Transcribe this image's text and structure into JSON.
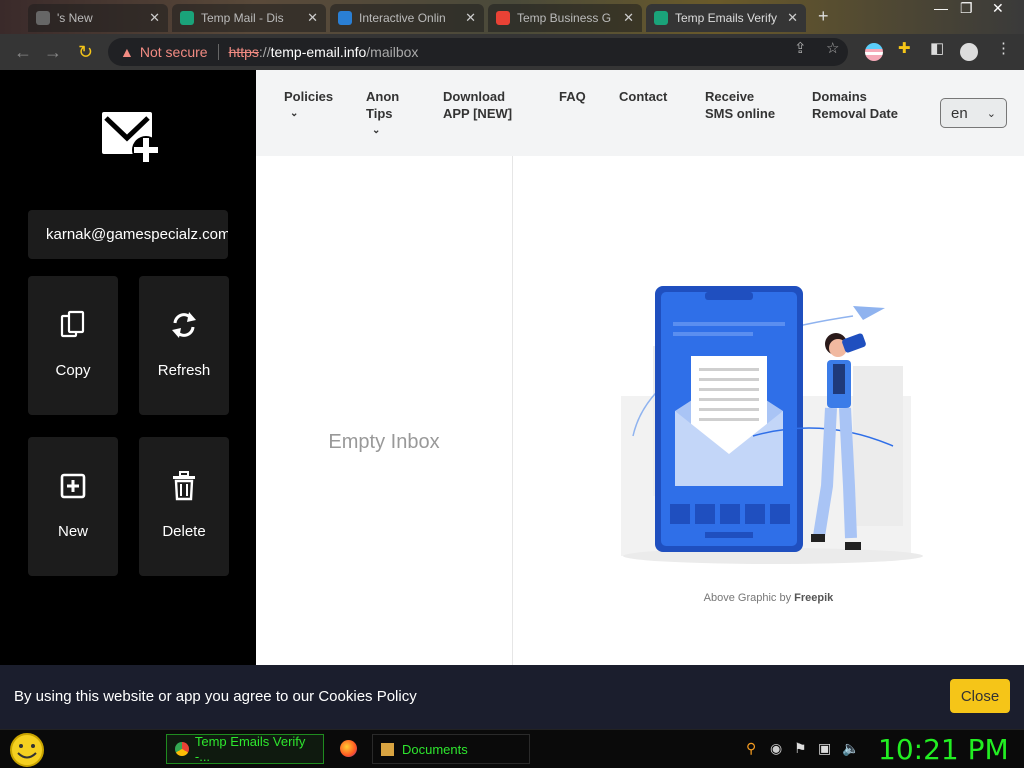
{
  "browser": {
    "tabs": [
      {
        "label": "'s New",
        "favicon_color": "#666666"
      },
      {
        "label": "Temp Mail - Dis",
        "favicon_color": "#1aa37a"
      },
      {
        "label": "Interactive Onlin",
        "favicon_color": "#2a7fd4"
      },
      {
        "label": "Temp Business G",
        "favicon_color": "#e94235"
      },
      {
        "label": "Temp Emails Verify",
        "favicon_color": "#1aa37a"
      }
    ],
    "close_glyph": "✕",
    "new_tab": "+",
    "window_controls": {
      "minimize": "—",
      "maximize": "❐",
      "close": "✕"
    },
    "address": {
      "not_secure": "Not secure",
      "scheme": "https",
      "separator": "://",
      "host": "temp-email.info",
      "path": "/mailbox"
    }
  },
  "sidebar": {
    "email": "karnak@gamespecialz.com",
    "actions": [
      {
        "label": "Copy",
        "icon": "copy-icon"
      },
      {
        "label": "Refresh",
        "icon": "refresh-icon"
      },
      {
        "label": "New",
        "icon": "plus-square-icon"
      },
      {
        "label": "Delete",
        "icon": "trash-icon"
      }
    ]
  },
  "nav": {
    "items": [
      {
        "line1": "Policies",
        "line2": "",
        "dropdown": true
      },
      {
        "line1": "Anon",
        "line2": "Tips",
        "dropdown": true
      },
      {
        "line1": "Download",
        "line2": "APP [NEW]",
        "dropdown": false
      },
      {
        "line1": "FAQ",
        "line2": "",
        "dropdown": false
      },
      {
        "line1": "Contact",
        "line2": "",
        "dropdown": false
      },
      {
        "line1": "Receive",
        "line2": "SMS online",
        "dropdown": false
      },
      {
        "line1": "Domains",
        "line2": "Removal Date",
        "dropdown": false
      }
    ],
    "language": "en"
  },
  "inbox": {
    "empty_text": "Empty Inbox"
  },
  "viewer": {
    "credit_prefix": "Above Graphic by",
    "credit_name": "Freepik"
  },
  "cookie": {
    "text": "By using this website or app you agree to our Cookies Policy",
    "button": "Close"
  },
  "taskbar": {
    "tasks": [
      {
        "label": "Temp Emails Verify -..."
      },
      {
        "label": "Documents"
      }
    ],
    "clock": "10:21 PM"
  },
  "colors": {
    "accent_yellow": "#f5c518",
    "sidebar_bg": "#000000",
    "clock_green": "#22ee22",
    "illustration_blue": "#2f6fe8"
  }
}
